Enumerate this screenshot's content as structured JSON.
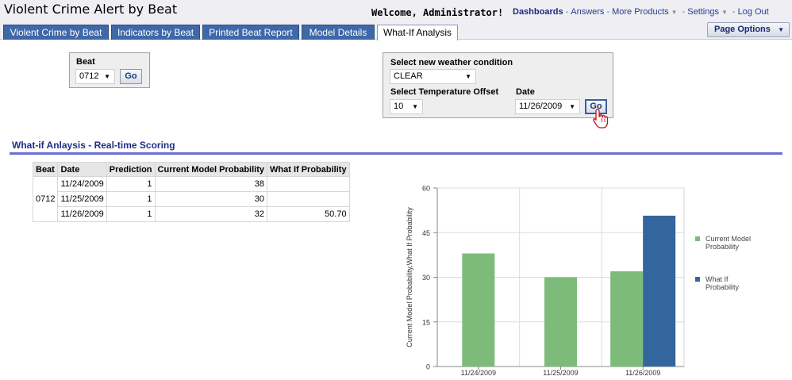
{
  "header": {
    "app_title": "Violent Crime Alert by Beat",
    "welcome": "Welcome, Administrator!",
    "nav": {
      "dashboards": "Dashboards",
      "answers": "Answers",
      "more_products": "More Products",
      "settings": "Settings",
      "logout": "Log Out"
    },
    "page_options": "Page Options"
  },
  "tabs": [
    {
      "label": "Violent Crime by Beat"
    },
    {
      "label": "Indicators by Beat"
    },
    {
      "label": "Printed Beat Report"
    },
    {
      "label": "Model Details"
    },
    {
      "label": "What-If Analysis",
      "active": true
    }
  ],
  "beat_prompt": {
    "label": "Beat",
    "value": "0712",
    "go": "Go"
  },
  "weather_prompt": {
    "weather_label": "Select new weather condition",
    "weather_value": "CLEAR",
    "temp_label": "Select Temperature Offset",
    "temp_value": "10",
    "date_label": "Date",
    "date_value": "11/26/2009",
    "go": "Go"
  },
  "section": {
    "title": "What-if Anlaysis - Real-time Scoring"
  },
  "table": {
    "columns": [
      "Beat",
      "Date",
      "Prediction",
      "Current Model Probability",
      "What If Probability"
    ],
    "beat": "0712",
    "rows": [
      {
        "date": "11/24/2009",
        "prediction": "1",
        "current": "38",
        "whatif": ""
      },
      {
        "date": "11/25/2009",
        "prediction": "1",
        "current": "30",
        "whatif": ""
      },
      {
        "date": "11/26/2009",
        "prediction": "1",
        "current": "32",
        "whatif": "50.70"
      }
    ]
  },
  "chart_data": {
    "type": "bar",
    "categories": [
      "11/24/2009",
      "11/25/2009",
      "11/26/2009"
    ],
    "series": [
      {
        "name": "Current Model Probability",
        "values": [
          38,
          30,
          32
        ],
        "color": "#7dbb7a"
      },
      {
        "name": "What If Probability",
        "values": [
          null,
          null,
          50.7
        ],
        "color": "#33669c"
      }
    ],
    "ylabel": "Current Model Probability,What If Probability",
    "ylim": [
      0,
      60
    ],
    "yticks": [
      "0",
      "15",
      "30",
      "45",
      "60"
    ],
    "legend_position": "right",
    "legend_lines": [
      [
        "Current Model",
        "Probability"
      ],
      [
        "What If",
        "Probability"
      ]
    ],
    "grid": true
  },
  "colors": {
    "tab_blue": "#3e68a8",
    "nav_link": "#2a3a8c",
    "section_title": "#1f2e82",
    "section_rule": "#6a6fd0"
  },
  "icons": {
    "cursor": "hand-pointer-icon",
    "dropdown": "chevron-down-icon"
  }
}
